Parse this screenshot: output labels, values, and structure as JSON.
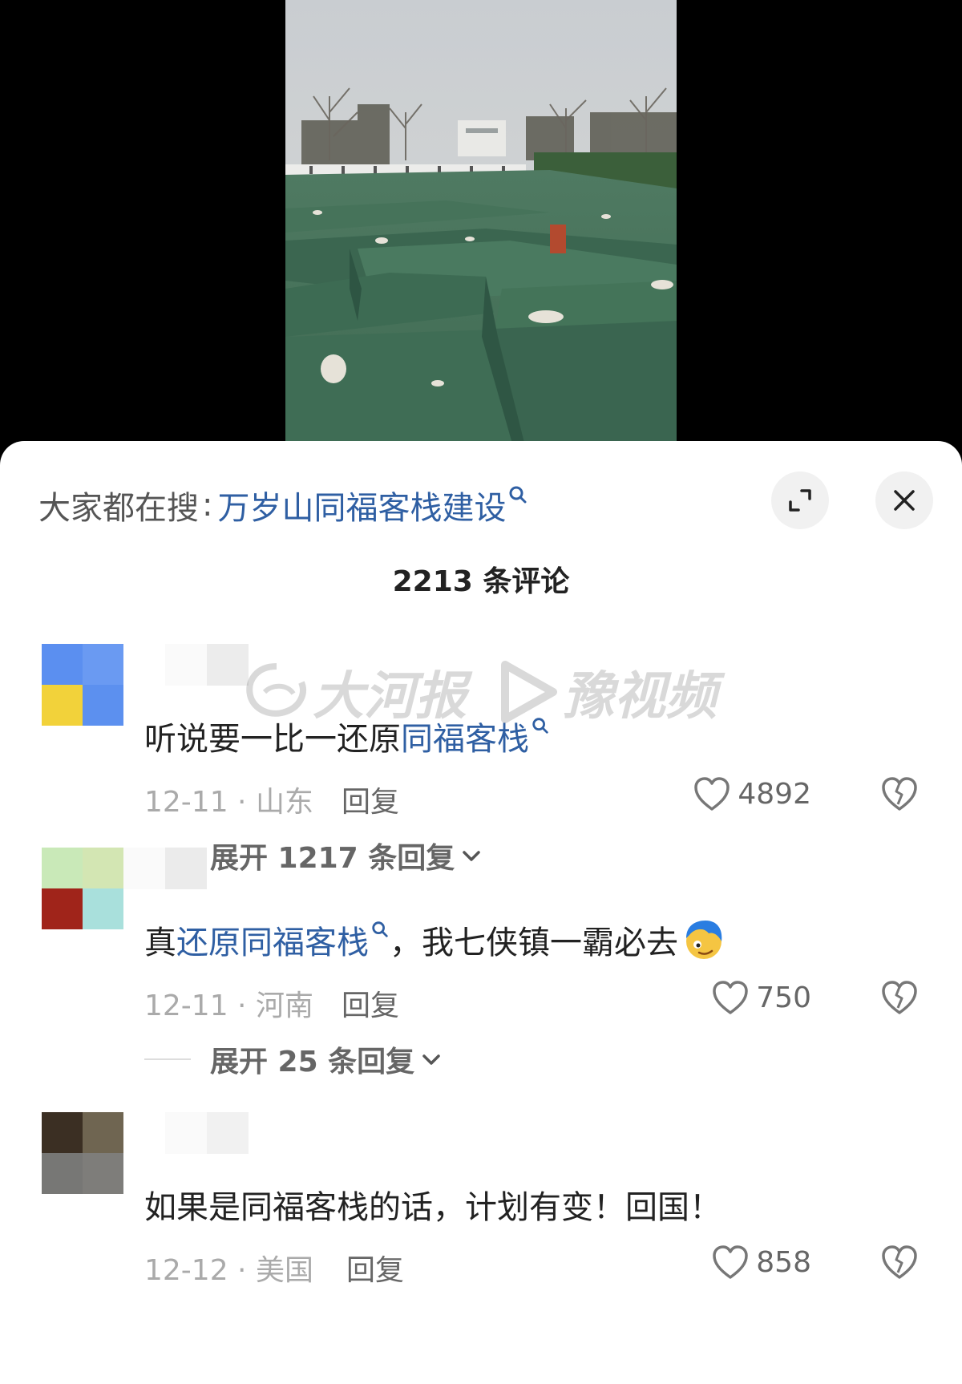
{
  "search": {
    "label": "大家都在搜",
    "separator": ":",
    "term": "万岁山同福客栈建设"
  },
  "comment_count": "2213 条评论",
  "watermark": {
    "brand_1": "大河报",
    "brand_2": "豫视频"
  },
  "comments": [
    {
      "text_parts": [
        "听说要一比一还原",
        " 同福客栈"
      ],
      "date_loc": "12-11 · 山东",
      "reply_label": "回复",
      "likes": "4892",
      "expand_label": "展开 1217 条回复",
      "avatar_colors": [
        "#5b8ff0",
        "#6a9af2",
        "#f2d23a",
        "#5c90ef"
      ]
    },
    {
      "text_parts": [
        "真",
        "还原同福客栈",
        "，我七侠镇一霸必去"
      ],
      "date_loc": "12-11 · 河南",
      "reply_label": "回复",
      "likes": "750",
      "expand_label": "展开 25 条回复",
      "avatar_colors": [
        "#c9e9b8",
        "#d3e6b3",
        "#a0241a",
        "#a9e0dc"
      ]
    },
    {
      "text_parts": [
        "如果是同福客栈的话，计划有变！回国！"
      ],
      "date_loc": "12-12 · 美国",
      "reply_label": "回复",
      "likes": "858",
      "avatar_colors": [
        "#3b2f23",
        "#6f6551",
        "#777775",
        "#7e7d7a"
      ]
    }
  ],
  "colors": {
    "link": "#2f5fa3",
    "tarp_green": "#3e6b52",
    "sky": "#c8cdd2"
  },
  "icons": [
    "search-icon",
    "expand-icon",
    "close-icon",
    "heart-icon",
    "broken-heart-icon",
    "chevron-down-icon"
  ]
}
